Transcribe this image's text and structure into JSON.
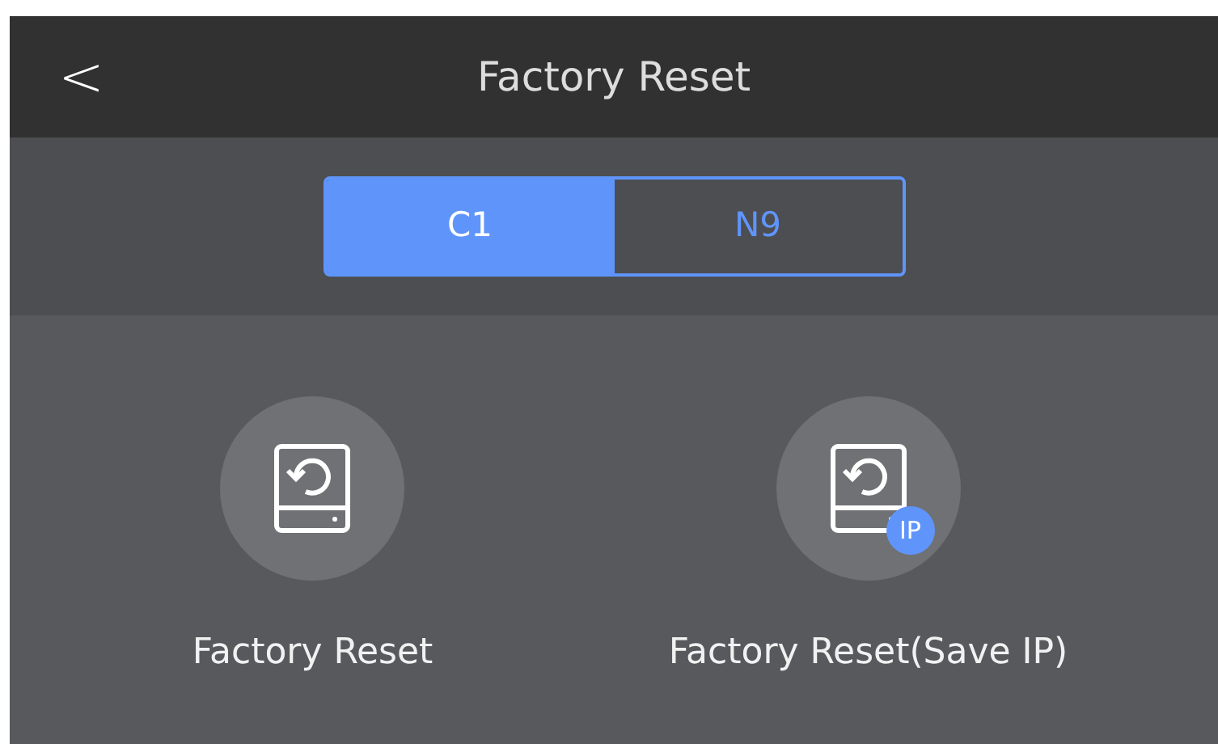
{
  "header": {
    "back": "<",
    "title": "Factory Reset"
  },
  "tabs": [
    {
      "label": "C1",
      "selected": true
    },
    {
      "label": "N9",
      "selected": false
    }
  ],
  "actions": [
    {
      "label": "Factory Reset"
    },
    {
      "label": "Factory Reset(Save IP)",
      "badge": "IP"
    }
  ]
}
